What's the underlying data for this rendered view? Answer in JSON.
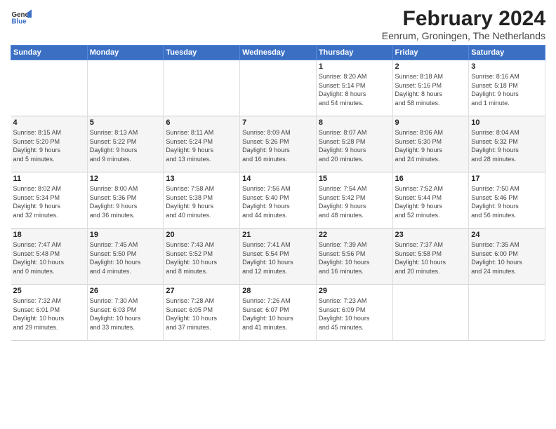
{
  "header": {
    "logo_line1": "General",
    "logo_line2": "Blue",
    "month_year": "February 2024",
    "location": "Eenrum, Groningen, The Netherlands"
  },
  "weekdays": [
    "Sunday",
    "Monday",
    "Tuesday",
    "Wednesday",
    "Thursday",
    "Friday",
    "Saturday"
  ],
  "weeks": [
    [
      {
        "day": "",
        "info": ""
      },
      {
        "day": "",
        "info": ""
      },
      {
        "day": "",
        "info": ""
      },
      {
        "day": "",
        "info": ""
      },
      {
        "day": "1",
        "info": "Sunrise: 8:20 AM\nSunset: 5:14 PM\nDaylight: 8 hours\nand 54 minutes."
      },
      {
        "day": "2",
        "info": "Sunrise: 8:18 AM\nSunset: 5:16 PM\nDaylight: 8 hours\nand 58 minutes."
      },
      {
        "day": "3",
        "info": "Sunrise: 8:16 AM\nSunset: 5:18 PM\nDaylight: 9 hours\nand 1 minute."
      }
    ],
    [
      {
        "day": "4",
        "info": "Sunrise: 8:15 AM\nSunset: 5:20 PM\nDaylight: 9 hours\nand 5 minutes."
      },
      {
        "day": "5",
        "info": "Sunrise: 8:13 AM\nSunset: 5:22 PM\nDaylight: 9 hours\nand 9 minutes."
      },
      {
        "day": "6",
        "info": "Sunrise: 8:11 AM\nSunset: 5:24 PM\nDaylight: 9 hours\nand 13 minutes."
      },
      {
        "day": "7",
        "info": "Sunrise: 8:09 AM\nSunset: 5:26 PM\nDaylight: 9 hours\nand 16 minutes."
      },
      {
        "day": "8",
        "info": "Sunrise: 8:07 AM\nSunset: 5:28 PM\nDaylight: 9 hours\nand 20 minutes."
      },
      {
        "day": "9",
        "info": "Sunrise: 8:06 AM\nSunset: 5:30 PM\nDaylight: 9 hours\nand 24 minutes."
      },
      {
        "day": "10",
        "info": "Sunrise: 8:04 AM\nSunset: 5:32 PM\nDaylight: 9 hours\nand 28 minutes."
      }
    ],
    [
      {
        "day": "11",
        "info": "Sunrise: 8:02 AM\nSunset: 5:34 PM\nDaylight: 9 hours\nand 32 minutes."
      },
      {
        "day": "12",
        "info": "Sunrise: 8:00 AM\nSunset: 5:36 PM\nDaylight: 9 hours\nand 36 minutes."
      },
      {
        "day": "13",
        "info": "Sunrise: 7:58 AM\nSunset: 5:38 PM\nDaylight: 9 hours\nand 40 minutes."
      },
      {
        "day": "14",
        "info": "Sunrise: 7:56 AM\nSunset: 5:40 PM\nDaylight: 9 hours\nand 44 minutes."
      },
      {
        "day": "15",
        "info": "Sunrise: 7:54 AM\nSunset: 5:42 PM\nDaylight: 9 hours\nand 48 minutes."
      },
      {
        "day": "16",
        "info": "Sunrise: 7:52 AM\nSunset: 5:44 PM\nDaylight: 9 hours\nand 52 minutes."
      },
      {
        "day": "17",
        "info": "Sunrise: 7:50 AM\nSunset: 5:46 PM\nDaylight: 9 hours\nand 56 minutes."
      }
    ],
    [
      {
        "day": "18",
        "info": "Sunrise: 7:47 AM\nSunset: 5:48 PM\nDaylight: 10 hours\nand 0 minutes."
      },
      {
        "day": "19",
        "info": "Sunrise: 7:45 AM\nSunset: 5:50 PM\nDaylight: 10 hours\nand 4 minutes."
      },
      {
        "day": "20",
        "info": "Sunrise: 7:43 AM\nSunset: 5:52 PM\nDaylight: 10 hours\nand 8 minutes."
      },
      {
        "day": "21",
        "info": "Sunrise: 7:41 AM\nSunset: 5:54 PM\nDaylight: 10 hours\nand 12 minutes."
      },
      {
        "day": "22",
        "info": "Sunrise: 7:39 AM\nSunset: 5:56 PM\nDaylight: 10 hours\nand 16 minutes."
      },
      {
        "day": "23",
        "info": "Sunrise: 7:37 AM\nSunset: 5:58 PM\nDaylight: 10 hours\nand 20 minutes."
      },
      {
        "day": "24",
        "info": "Sunrise: 7:35 AM\nSunset: 6:00 PM\nDaylight: 10 hours\nand 24 minutes."
      }
    ],
    [
      {
        "day": "25",
        "info": "Sunrise: 7:32 AM\nSunset: 6:01 PM\nDaylight: 10 hours\nand 29 minutes."
      },
      {
        "day": "26",
        "info": "Sunrise: 7:30 AM\nSunset: 6:03 PM\nDaylight: 10 hours\nand 33 minutes."
      },
      {
        "day": "27",
        "info": "Sunrise: 7:28 AM\nSunset: 6:05 PM\nDaylight: 10 hours\nand 37 minutes."
      },
      {
        "day": "28",
        "info": "Sunrise: 7:26 AM\nSunset: 6:07 PM\nDaylight: 10 hours\nand 41 minutes."
      },
      {
        "day": "29",
        "info": "Sunrise: 7:23 AM\nSunset: 6:09 PM\nDaylight: 10 hours\nand 45 minutes."
      },
      {
        "day": "",
        "info": ""
      },
      {
        "day": "",
        "info": ""
      }
    ]
  ]
}
